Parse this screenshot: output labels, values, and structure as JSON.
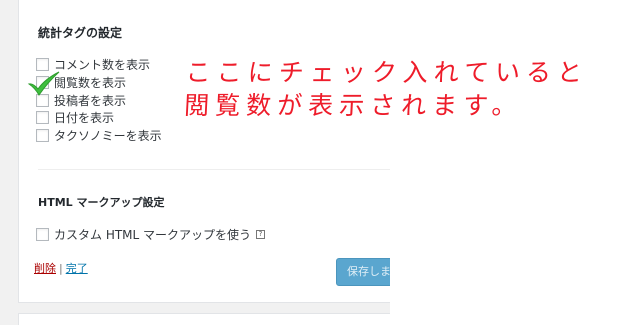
{
  "settings_panel": {
    "stats_tag_title": "統計タグの設定",
    "stats_options": [
      {
        "label": "コメント数を表示",
        "checked": false
      },
      {
        "label": "閲覧数を表示",
        "checked": false
      },
      {
        "label": "投稿者を表示",
        "checked": false
      },
      {
        "label": "日付を表示",
        "checked": false
      },
      {
        "label": "タクソノミーを表示",
        "checked": false
      }
    ],
    "markup_title": "HTML マークアップ設定",
    "custom_markup_label": "カスタム HTML マークアップを使う",
    "custom_markup_checked": false,
    "help_icon": "?",
    "delete_link": "削除",
    "separator": "|",
    "done_link": "完了",
    "save_button": "保存しま"
  },
  "annotation": {
    "line1": "ここにチェック入れていると",
    "line2": "閲覧数が表示されます。",
    "color": "#ee1c2a",
    "checkmark_icon": "green-checkmark-icon"
  },
  "colors": {
    "background": "#f1f1f1",
    "panel": "#ffffff",
    "delete_link": "#aa0000",
    "link": "#0073aa",
    "button": "#5aa6cf",
    "checkmark": "#3fbf3f"
  }
}
